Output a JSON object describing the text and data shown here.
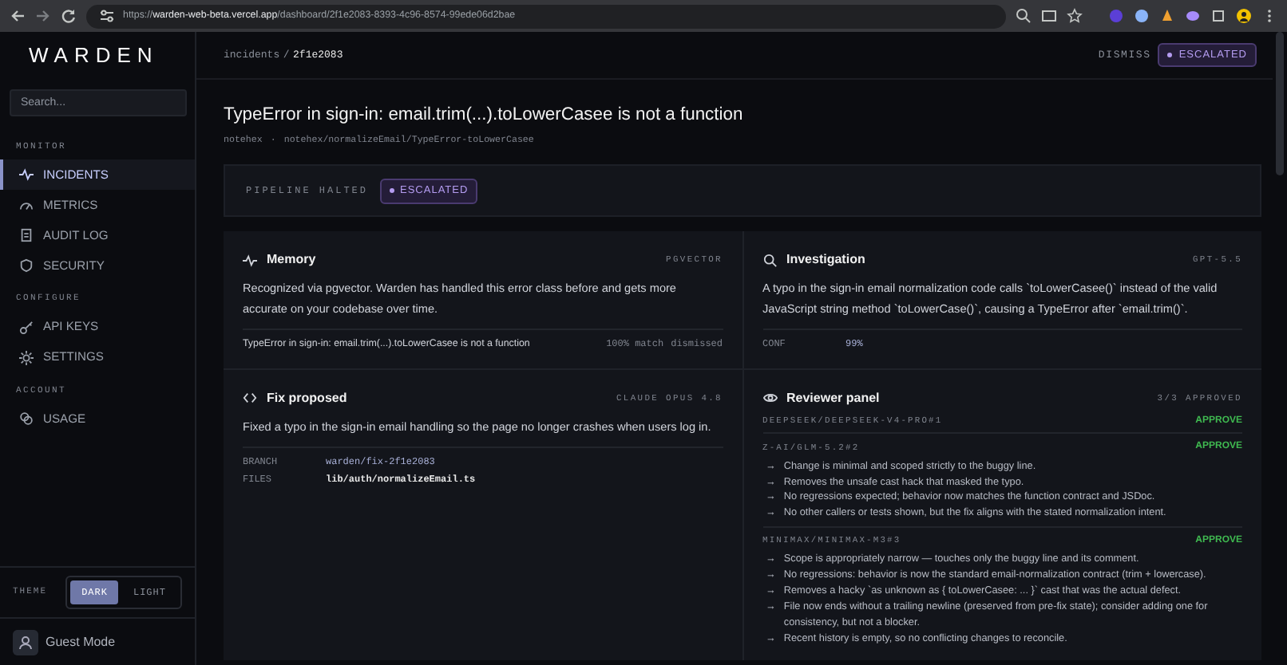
{
  "browser": {
    "url_scheme": "https://",
    "url_host": "warden-web-beta.vercel.app",
    "url_path": "/dashboard/2f1e2083-8393-4c96-8574-99ede06d2bae"
  },
  "sidebar": {
    "logo": "WARDEN",
    "search": {
      "placeholder": "Search..."
    },
    "sections": [
      {
        "label": "MONITOR",
        "items": [
          {
            "label": "INCIDENTS",
            "selected": true
          },
          {
            "label": "METRICS",
            "selected": false
          },
          {
            "label": "AUDIT LOG",
            "selected": false
          },
          {
            "label": "SECURITY",
            "selected": false
          }
        ]
      },
      {
        "label": "CONFIGURE",
        "items": [
          {
            "label": "API KEYS",
            "selected": false
          },
          {
            "label": "SETTINGS",
            "selected": false
          }
        ]
      },
      {
        "label": "ACCOUNT",
        "items": [
          {
            "label": "USAGE",
            "selected": false
          }
        ]
      }
    ],
    "theme": {
      "label": "THEME",
      "options": [
        {
          "label": "DARK",
          "selected": true
        },
        {
          "label": "LIGHT",
          "selected": false
        }
      ]
    },
    "user": {
      "name": "Guest Mode"
    }
  },
  "header": {
    "breadcrumb": [
      "incidents",
      "2f1e2083"
    ],
    "separator": "/",
    "dismiss": "DISMISS",
    "status": "ESCALATED"
  },
  "incident": {
    "title": "TypeError in sign-in: email.trim(...).toLowerCasee is not a function",
    "source": "notehex",
    "separator": "·",
    "path": "notehex/normalizeEmail/TypeError-toLowerCasee"
  },
  "pipeline": {
    "label": "PIPELINE HALTED",
    "status": "ESCALATED"
  },
  "memory": {
    "title": "Memory",
    "tag": "PGVECTOR",
    "text": "Recognized via pgvector. Warden has handled this error class before and gets more accurate on your codebase over time.",
    "match": {
      "title": "TypeError in sign-in: email.trim(...).toLowerCasee is not a function",
      "score": "100% match",
      "state": "dismissed"
    }
  },
  "investigation": {
    "title": "Investigation",
    "tag": "GPT-5.5",
    "text": "A typo in the sign-in email normalization code calls `toLowerCasee()` instead of the valid JavaScript string method `toLowerCase()`, causing a TypeError after `email.trim()`.",
    "conf_label": "CONF",
    "conf_value": "99%"
  },
  "fix": {
    "title": "Fix proposed",
    "tag": "CLAUDE OPUS 4.8",
    "text": "Fixed a typo in the sign-in email handling so the page no longer crashes when users log in.",
    "fields": [
      {
        "label": "BRANCH",
        "value": "warden/fix-2f1e2083",
        "kind": "link"
      },
      {
        "label": "FILES",
        "value": "lib/auth/normalizeEmail.ts",
        "kind": "file"
      }
    ]
  },
  "reviewers": {
    "title": "Reviewer panel",
    "tag": "3/3 APPROVED",
    "reviews": [
      {
        "model": "DEEPSEEK/DEEPSEEK-V4-PRO#1",
        "verdict": "APPROVE"
      },
      {
        "model": "Z-AI/GLM-5.2#2",
        "verdict": "APPROVE",
        "notes": [
          "Change is minimal and scoped strictly to the buggy line.",
          "Removes the unsafe cast hack that masked the typo.",
          "No regressions expected; behavior now matches the function contract and JSDoc.",
          "No other callers or tests shown, but the fix aligns with the stated normalization intent."
        ]
      },
      {
        "model": "MINIMAX/MINIMAX-M3#3",
        "verdict": "APPROVE",
        "notes": [
          "Scope is appropriately narrow — touches only the buggy line and its comment.",
          "No regressions: behavior is now the standard email-normalization contract (trim + lowercase).",
          "Removes a hacky `as unknown as { toLowerCasee: ... }` cast that was the actual defect.",
          "File now ends without a trailing newline (preserved from pre-fix state); consider adding one for consistency, but not a blocker.",
          "Recent history is empty, so no conflicting changes to reconcile."
        ]
      }
    ],
    "marker": "→"
  }
}
